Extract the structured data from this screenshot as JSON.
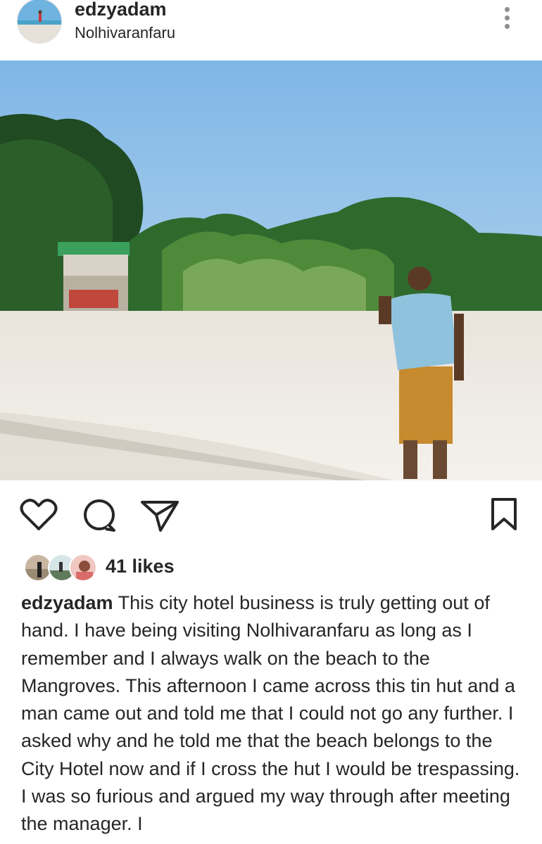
{
  "post": {
    "username": "edzyadam",
    "location": "Nolhivaranfaru",
    "likes": "41 likes",
    "caption_username": "edzyadam",
    "caption_text": "This city hotel business is truly getting out of hand. I have being visiting Nolhivaranfaru as long as I remember and I always walk on the beach to the Mangroves. This afternoon I came across this tin hut and a man came out and told me that I could not go any further. I asked why and he told me that the beach belongs to the City Hotel now and if I cross the hut I would be trespassing. I was so furious and argued my way through after meeting the manager. I"
  },
  "icons": {
    "more": "more-vertical-icon",
    "like": "heart-icon",
    "comment": "comment-icon",
    "share": "paper-plane-icon",
    "save": "bookmark-icon"
  },
  "colors": {
    "text": "#262626",
    "muted": "#8e8e8e",
    "sky": "#a9d0ec",
    "sand": "#efeae2"
  }
}
